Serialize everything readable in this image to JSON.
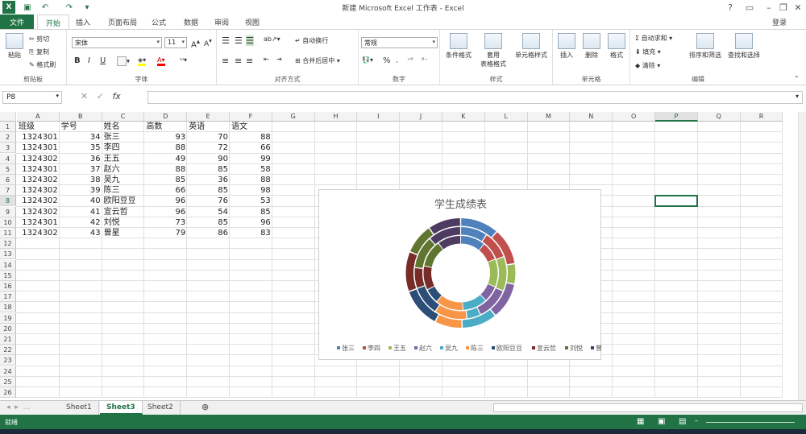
{
  "window": {
    "title": "新建 Microsoft Excel 工作表 - Excel",
    "login": "登录",
    "help": "?"
  },
  "tabs": [
    "文件",
    "开始",
    "插入",
    "页面布局",
    "公式",
    "数据",
    "审阅",
    "视图"
  ],
  "ribbon": {
    "clipboard": {
      "label": "剪贴板",
      "paste": "粘贴",
      "cut": "剪切",
      "copy": "复制",
      "format_painter": "格式刷"
    },
    "font": {
      "label": "字体",
      "name": "宋体",
      "size": "11",
      "bold": "B",
      "italic": "I",
      "underline": "U"
    },
    "align": {
      "label": "对齐方式",
      "wrap": "自动换行",
      "merge": "合并后居中"
    },
    "number": {
      "label": "数字",
      "format": "常规",
      "percent": "%"
    },
    "styles": {
      "label": "样式",
      "cond": "条件格式",
      "table1": "套用",
      "table2": "表格格式",
      "cell": "单元格样式"
    },
    "cells": {
      "label": "单元格",
      "insert": "插入",
      "delete": "删除",
      "format": "格式"
    },
    "edit": {
      "label": "编辑",
      "autosum": "自动求和",
      "fill": "填充",
      "clear": "清除",
      "sort": "排序和筛选",
      "find": "查找和选择"
    }
  },
  "formula_bar": {
    "name_box": "P8",
    "fx": "fx",
    "value": ""
  },
  "columns": [
    "A",
    "B",
    "C",
    "D",
    "E",
    "F",
    "G",
    "H",
    "I",
    "J",
    "K",
    "L",
    "M",
    "N",
    "O",
    "P",
    "Q",
    "R"
  ],
  "selected_col": "P",
  "rows": [
    "1",
    "2",
    "3",
    "4",
    "5",
    "6",
    "7",
    "8",
    "9",
    "10",
    "11",
    "12",
    "13",
    "14",
    "15",
    "16",
    "17",
    "18",
    "19",
    "20",
    "21",
    "22",
    "23",
    "24",
    "25",
    "26"
  ],
  "selected_row": "8",
  "headers": [
    "班级",
    "学号",
    "姓名",
    "高数",
    "英语",
    "语文"
  ],
  "data": [
    [
      "1324301",
      "34",
      "张三",
      "93",
      "70",
      "88"
    ],
    [
      "1324301",
      "35",
      "李四",
      "88",
      "72",
      "66"
    ],
    [
      "1324302",
      "36",
      "王五",
      "49",
      "90",
      "99"
    ],
    [
      "1324301",
      "37",
      "赵六",
      "88",
      "85",
      "58"
    ],
    [
      "1324302",
      "38",
      "吴九",
      "85",
      "36",
      "88"
    ],
    [
      "1324302",
      "39",
      "陈三",
      "66",
      "85",
      "98"
    ],
    [
      "1324302",
      "40",
      "欧阳豆豆",
      "96",
      "76",
      "53"
    ],
    [
      "1324302",
      "41",
      "宣云哲",
      "96",
      "54",
      "85"
    ],
    [
      "1324301",
      "42",
      "刘悦",
      "73",
      "85",
      "96"
    ],
    [
      "1324302",
      "43",
      "曾星",
      "79",
      "86",
      "83"
    ]
  ],
  "chart_data": {
    "type": "doughnut",
    "title": "学生成绩表",
    "categories": [
      "张三",
      "李四",
      "王五",
      "赵六",
      "吴九",
      "陈三",
      "欧阳豆豆",
      "宣云哲",
      "刘悦",
      "曾星"
    ],
    "series": [
      {
        "values": [
          93,
          88,
          49,
          88,
          85,
          66,
          96,
          96,
          73,
          79
        ]
      },
      {
        "values": [
          70,
          72,
          90,
          85,
          36,
          85,
          76,
          54,
          85,
          86
        ]
      },
      {
        "values": [
          88,
          66,
          99,
          58,
          88,
          98,
          53,
          85,
          96,
          83
        ]
      }
    ],
    "colors": [
      "#4f81bd",
      "#c0504d",
      "#9bbb59",
      "#8064a2",
      "#4bacc6",
      "#f79646",
      "#2c4d75",
      "#772c2a",
      "#5f7530",
      "#4d3b62"
    ],
    "legend": "bottom"
  },
  "sheets": [
    "Sheet1",
    "Sheet3",
    "Sheet2"
  ],
  "active_sheet": "Sheet3",
  "status": {
    "ready": "就绪"
  }
}
